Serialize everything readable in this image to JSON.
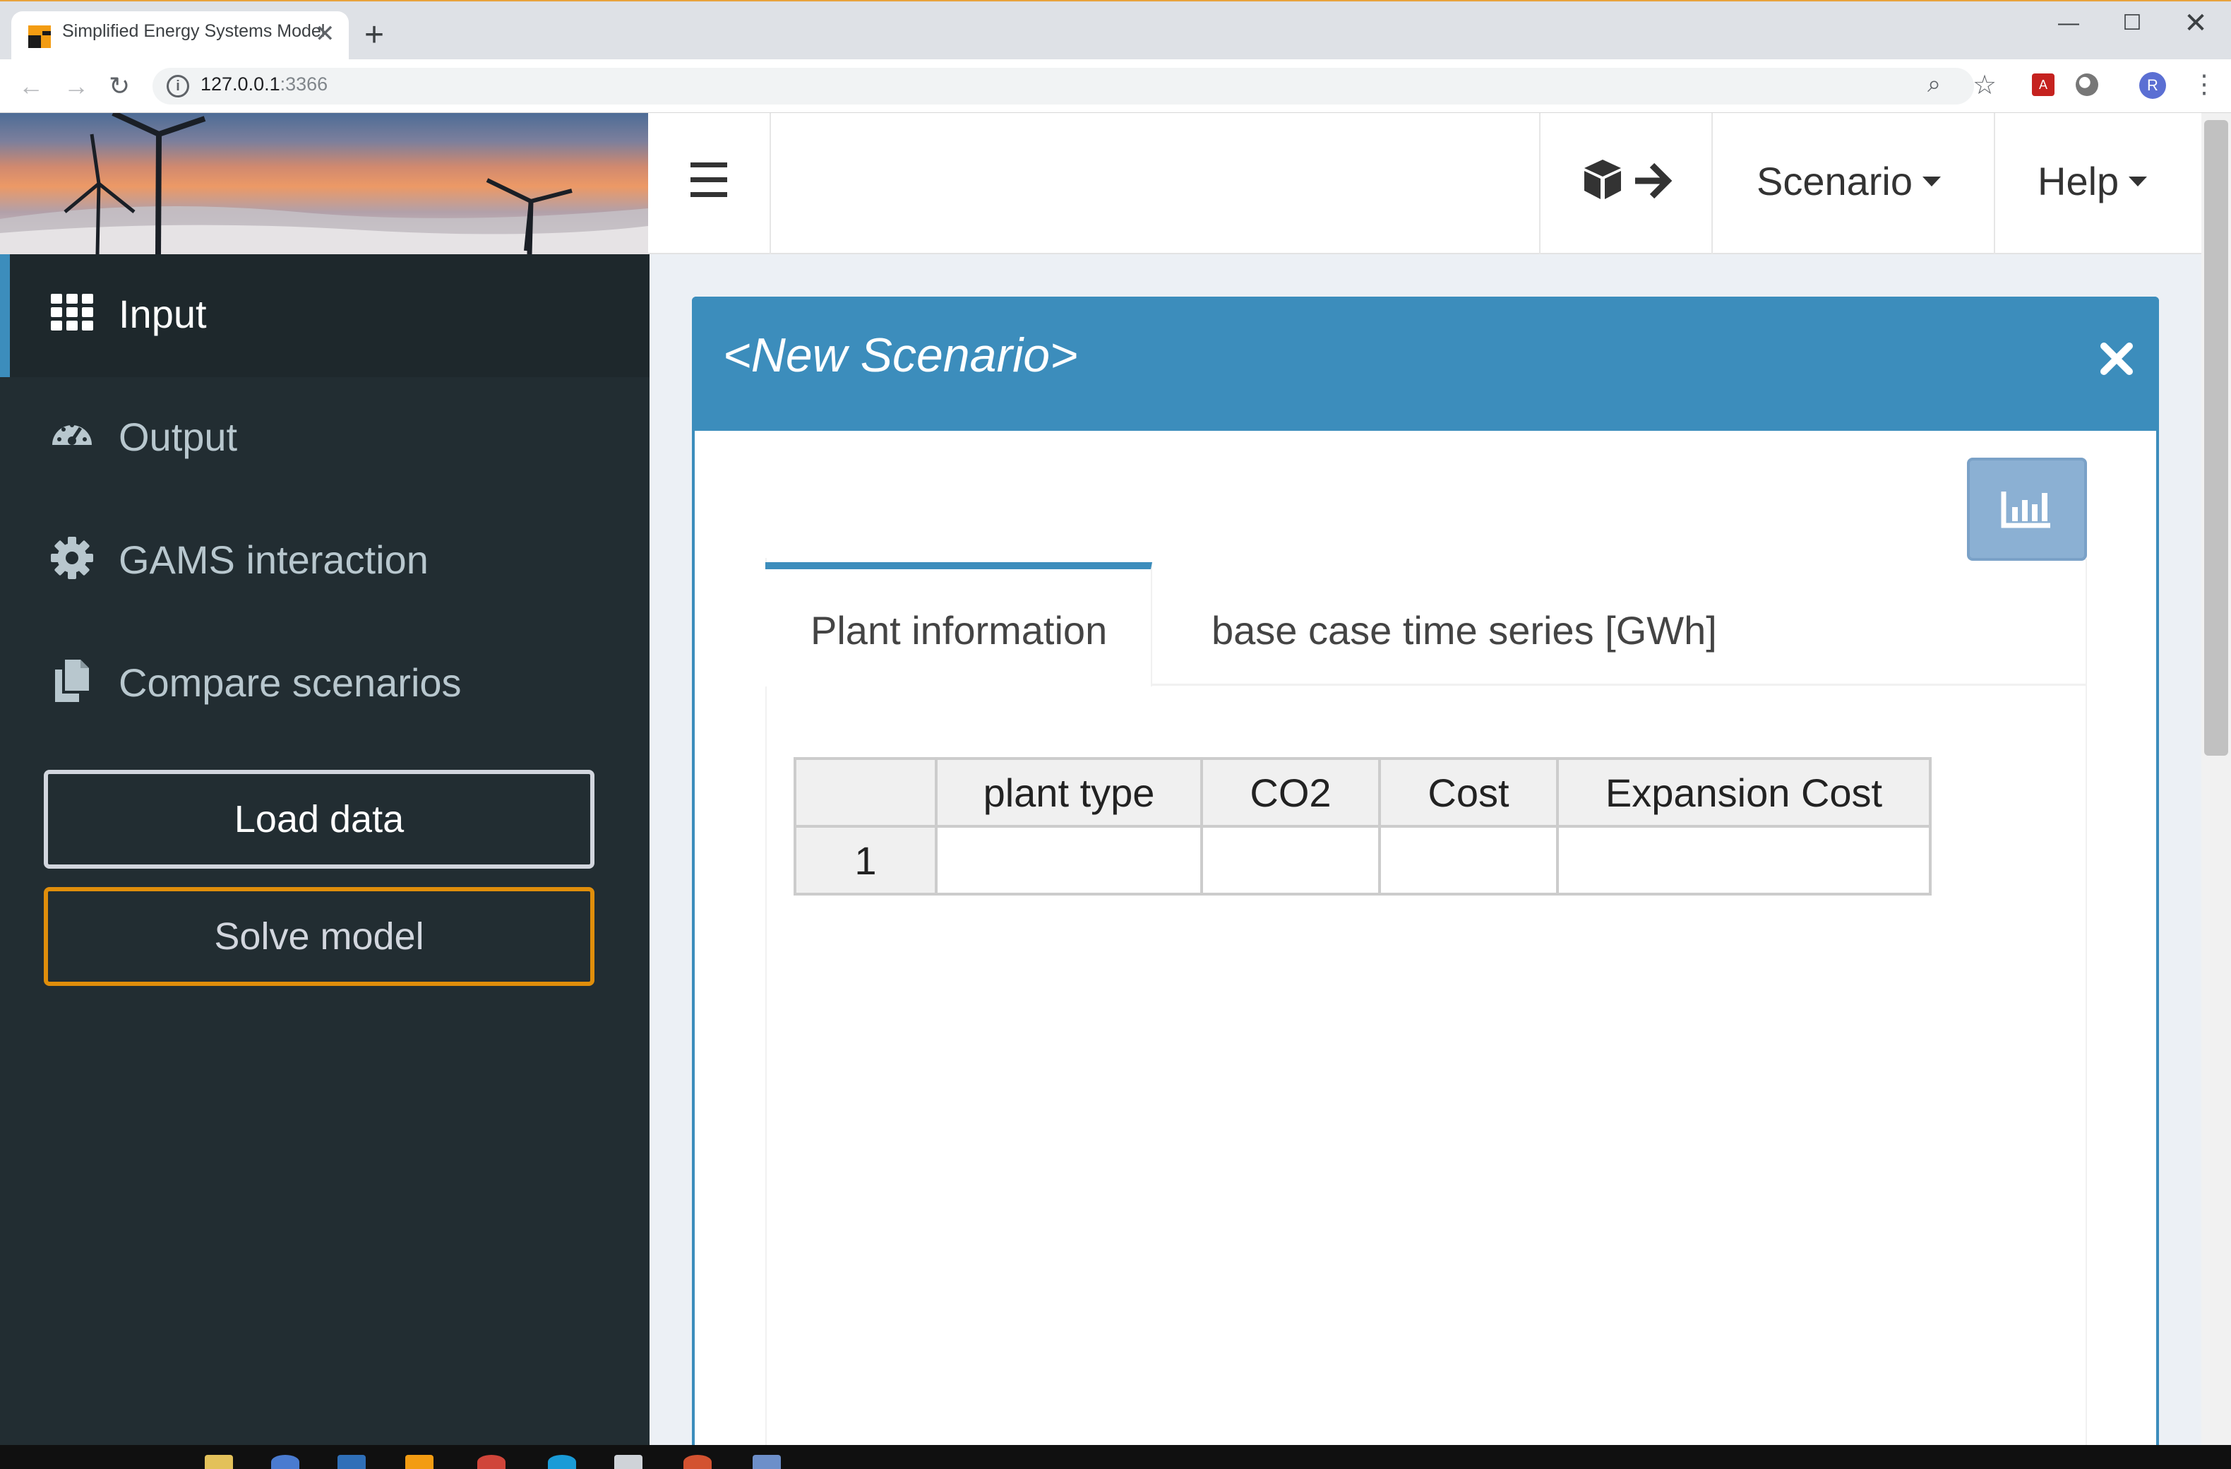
{
  "browser": {
    "tab_title": "Simplified Energy Systems Model",
    "url_host": "127.0.0.1",
    "url_port": ":3366",
    "tab_close_glyph": "✕",
    "new_tab_glyph": "+",
    "window_min_glyph": "—",
    "window_max_glyph": "☐",
    "window_close_glyph": "✕",
    "profile_initial": "R",
    "pdf_label": "A",
    "icons": [
      "back-arrow-icon",
      "forward-arrow-icon",
      "reload-icon",
      "site-info-icon",
      "zoom-icon",
      "bookmark-star-icon",
      "pdf-extension-icon",
      "extension-icon",
      "profile-avatar",
      "menu-dots-icon"
    ]
  },
  "header": {
    "scenario_label": "Scenario",
    "help_label": "Help",
    "export_icon": "cube-arrow-export-icon",
    "menu_icon": "hamburger-menu-icon"
  },
  "sidebar": {
    "items": [
      {
        "label": "Input",
        "icon": "grid-icon",
        "active": true
      },
      {
        "label": "Output",
        "icon": "dashboard-gauge-icon",
        "active": false
      },
      {
        "label": "GAMS interaction",
        "icon": "gear-icon",
        "active": false
      },
      {
        "label": "Compare scenarios",
        "icon": "copy-files-icon",
        "active": false
      }
    ],
    "load_data_label": "Load data",
    "solve_model_label": "Solve model"
  },
  "scenario_box": {
    "title": "<New Scenario>",
    "close_icon": "close-x-icon",
    "chart_toggle_icon": "bar-chart-icon",
    "tabs": [
      {
        "label": "Plant information",
        "active": true
      },
      {
        "label": "base case time series [GWh]",
        "active": false
      }
    ],
    "table": {
      "columns": [
        "",
        "plant type",
        "CO2",
        "Cost",
        "Expansion Cost"
      ],
      "rows": [
        {
          "index": "1",
          "cells": [
            "",
            "",
            "",
            ""
          ]
        }
      ]
    }
  },
  "colors": {
    "accent": "#3c8dbc",
    "sidebar_bg": "#222d32",
    "solve_border": "#e08e0b"
  }
}
